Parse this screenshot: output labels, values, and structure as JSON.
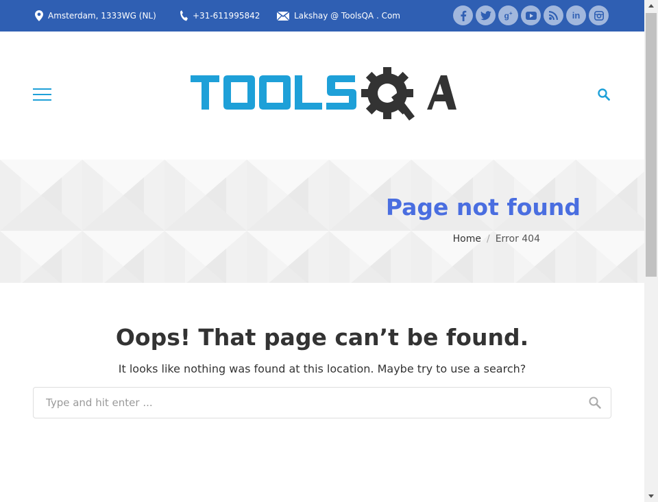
{
  "topbar": {
    "address": "Amsterdam, 1333WG (NL)",
    "phone": "+31-611995842",
    "email": "Lakshay @ ToolsQA . Com",
    "socials": [
      {
        "name": "facebook",
        "glyph": "f"
      },
      {
        "name": "twitter",
        "glyph": "t"
      },
      {
        "name": "google-plus",
        "glyph": "g+"
      },
      {
        "name": "youtube",
        "glyph": "▶"
      },
      {
        "name": "rss",
        "glyph": "rss"
      },
      {
        "name": "linkedin",
        "glyph": "in"
      },
      {
        "name": "instagram",
        "glyph": "ig"
      }
    ],
    "colors": {
      "bar": "#2f5fb3"
    }
  },
  "header": {
    "logo": {
      "text_tools": "TOOLS",
      "text_q": "Q",
      "text_a": "A",
      "tools_color": "#1ea0d8",
      "qa_color": "#333333"
    },
    "icons": [
      "hamburger-menu-icon",
      "search-icon"
    ]
  },
  "banner": {
    "title": "Page not found",
    "breadcrumb": {
      "home": "Home",
      "separator": "/",
      "current": "Error 404"
    }
  },
  "main": {
    "heading": "Oops! That page can’t be found.",
    "message": "It looks like nothing was found at this location. Maybe try to use a search?",
    "search": {
      "placeholder": "Type and hit enter ...",
      "value": ""
    }
  }
}
